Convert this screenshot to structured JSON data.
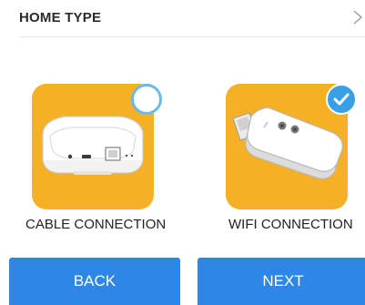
{
  "header": {
    "title": "HOME TYPE",
    "chevron_icon": "chevron-right-icon"
  },
  "options": [
    {
      "label": "CABLE CONNECTION",
      "icon": "router-device-icon",
      "selected": false
    },
    {
      "label": "WIFI CONNECTION",
      "icon": "wifi-dongle-icon",
      "selected": true
    }
  ],
  "buttons": {
    "back_label": "BACK",
    "next_label": "NEXT"
  },
  "colors": {
    "accent": "#2e86e6",
    "card": "#f4b126",
    "check": "#3aa0e6"
  }
}
